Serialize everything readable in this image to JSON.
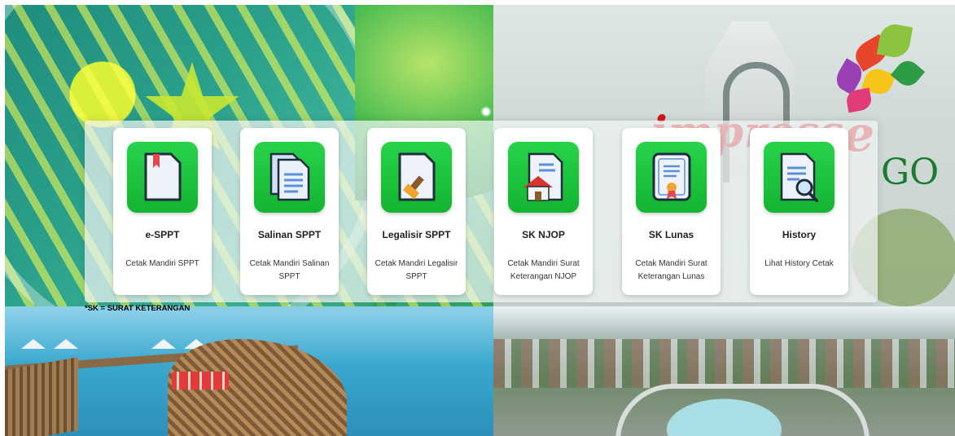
{
  "cards": [
    {
      "title": "e-SPPT",
      "desc": "Cetak Mandiri SPPT"
    },
    {
      "title": "Salinan SPPT",
      "desc": "Cetak Mandiri Salinan SPPT"
    },
    {
      "title": "Legalisir SPPT",
      "desc": "Cetak Mandiri Legalisir SPPT"
    },
    {
      "title": "SK NJOP",
      "desc": "Cetak Mandiri Surat Keterangan NJOP"
    },
    {
      "title": "SK Lunas",
      "desc": "Cetak Mandiri Surat Keterangan Lunas"
    },
    {
      "title": "History",
      "desc": "Lihat History Cetak"
    }
  ],
  "footnote": "*SK = SURAT KETERANGAN",
  "brand": {
    "text": "impress",
    "letter": "e",
    "suffix": "GO"
  },
  "icons": [
    "document-bookmark-icon",
    "document-copy-icon",
    "document-stamp-icon",
    "document-house-icon",
    "certificate-icon",
    "document-search-icon"
  ],
  "colors": {
    "icon_bg": "#1cc83d",
    "title": "#222222",
    "brand_red": "#d6141c",
    "brand_green": "#1d7a30"
  }
}
